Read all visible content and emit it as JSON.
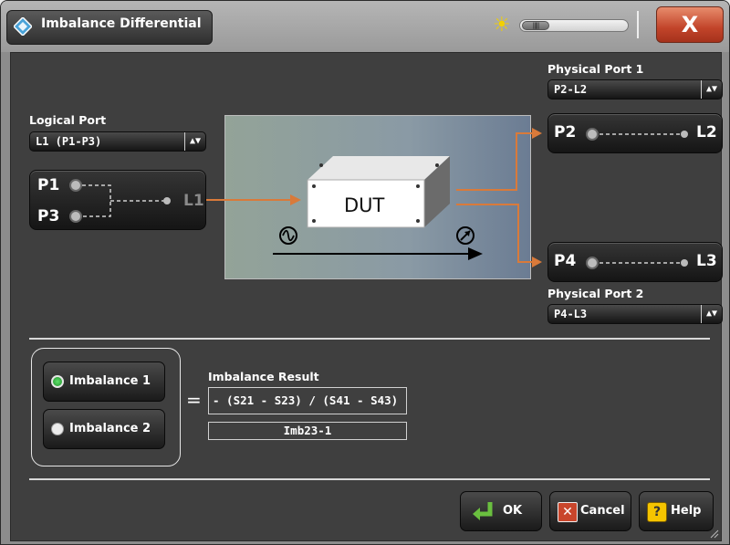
{
  "window": {
    "title": "Imbalance Differential",
    "close_label": "X"
  },
  "colors": {
    "arrow": "#d97a3a",
    "close": "#c2442a",
    "radio_on": "#2ea83a"
  },
  "logical": {
    "label": "Logical Port",
    "value": "L1 (P1-P3)"
  },
  "left_panel": {
    "p1": "P1",
    "p3": "P3",
    "l1": "L1"
  },
  "diagram": {
    "dut": "DUT",
    "source_icon": "sine-source-icon",
    "receiver_icon": "receiver-icon"
  },
  "physical1": {
    "label": "Physical Port 1",
    "value": "P2-L2",
    "port": "P2",
    "logical": "L2"
  },
  "physical2": {
    "label": "Physical Port 2",
    "value": "P4-L3",
    "port": "P4",
    "logical": "L3"
  },
  "imbalance": {
    "options": [
      {
        "label": "Imbalance 1",
        "selected": true
      },
      {
        "label": "Imbalance 2",
        "selected": false
      }
    ],
    "result_label": "Imbalance Result",
    "formula": "- (S21 - S23) / (S41 - S43)",
    "trace_name": "Imb23-1"
  },
  "buttons": {
    "ok": "OK",
    "cancel": "Cancel",
    "help": "Help"
  }
}
